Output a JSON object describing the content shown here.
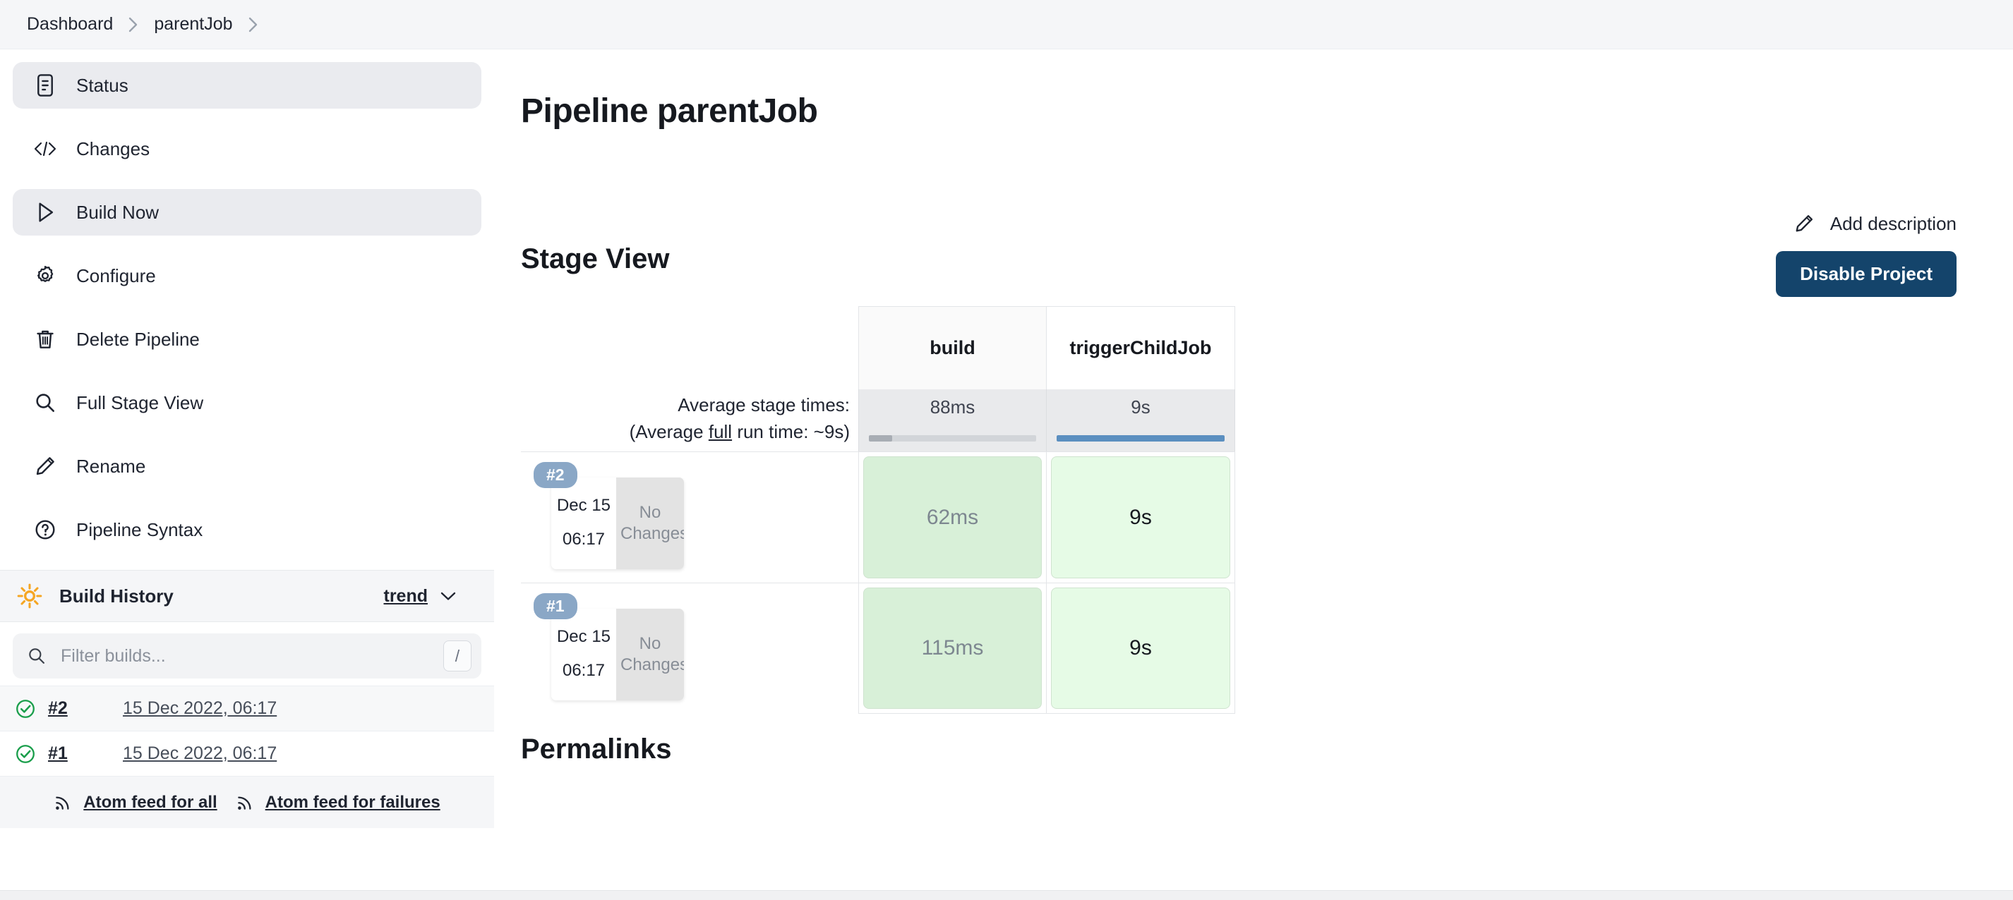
{
  "breadcrumb": {
    "items": [
      {
        "label": "Dashboard"
      },
      {
        "label": "parentJob"
      }
    ]
  },
  "sidebar": {
    "nav": [
      {
        "label": "Status",
        "icon": "document-icon",
        "active": true
      },
      {
        "label": "Changes",
        "icon": "code-icon",
        "active": false
      },
      {
        "label": "Build Now",
        "icon": "play-icon",
        "active": true
      },
      {
        "label": "Configure",
        "icon": "gear-icon",
        "active": false
      },
      {
        "label": "Delete Pipeline",
        "icon": "trash-icon",
        "active": false
      },
      {
        "label": "Full Stage View",
        "icon": "search-icon",
        "active": false
      },
      {
        "label": "Rename",
        "icon": "pencil-icon",
        "active": false
      },
      {
        "label": "Pipeline Syntax",
        "icon": "help-circle-icon",
        "active": false
      }
    ],
    "build_history": {
      "title": "Build History",
      "trend_label": "trend",
      "filter_placeholder": "Filter builds...",
      "filter_value": "",
      "filter_shortcut": "/",
      "builds": [
        {
          "number": "#2",
          "timestamp": "15 Dec 2022, 06:17",
          "status": "success"
        },
        {
          "number": "#1",
          "timestamp": "15 Dec 2022, 06:17",
          "status": "success"
        }
      ],
      "feeds": [
        {
          "label": "Atom feed for all"
        },
        {
          "label": "Atom feed for failures"
        }
      ]
    }
  },
  "main": {
    "title": "Pipeline parentJob",
    "add_description_label": "Add description",
    "disable_project_label": "Disable Project",
    "stage_view_heading": "Stage View",
    "permalinks_heading": "Permalinks"
  },
  "stage_view": {
    "average_label_line1": "Average stage times:",
    "average_label_line2_pre": "(Average ",
    "average_label_line2_underline": "full",
    "average_label_line2_post": " run time: ~9s)",
    "stages": [
      {
        "name": "build",
        "average": "88ms",
        "bar_pct": 14,
        "bar_color": "#a8adb4"
      },
      {
        "name": "triggerChildJob",
        "average": "9s",
        "bar_pct": 100,
        "bar_color": "#5b8fc0"
      }
    ],
    "runs": [
      {
        "build": "#2",
        "date": "Dec 15",
        "time": "06:17",
        "changes_line1": "No",
        "changes_line2": "Changes",
        "cells": [
          {
            "value": "62ms",
            "style": "pale"
          },
          {
            "value": "9s",
            "style": "bright"
          }
        ]
      },
      {
        "build": "#1",
        "date": "Dec 15",
        "time": "06:17",
        "changes_line1": "No",
        "changes_line2": "Changes",
        "cells": [
          {
            "value": "115ms",
            "style": "pale"
          },
          {
            "value": "9s",
            "style": "bright"
          }
        ]
      }
    ]
  },
  "colors": {
    "accent_button": "#14446b",
    "success": "#1a9e4b",
    "badge": "#8aa7c6",
    "sun": "#f5a623",
    "stage_pale": "#d8f0d8",
    "stage_bright": "#e6fbe6"
  }
}
